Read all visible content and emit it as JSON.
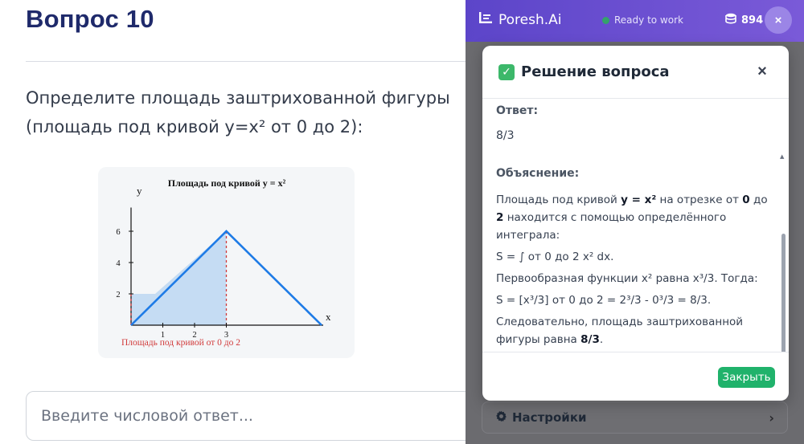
{
  "question": {
    "title": "Вопрос 10",
    "text": "Определите площадь заштрихованной фигуры (площадь под кривой y=x² от 0 до 2):",
    "input_placeholder": "Введите числовой ответ..."
  },
  "figure": {
    "title": "Площадь под кривой y = x²",
    "x_axis_label": "x",
    "y_axis_label": "y",
    "x_ticks": [
      "1",
      "2",
      "3"
    ],
    "y_ticks": [
      "2",
      "4",
      "6"
    ],
    "caption": "Площадь под кривой от 0 до 2",
    "colors": {
      "line": "#1e7be6",
      "fill": "#c5dcf3",
      "dashed": "#d13a3a",
      "caption": "#d13a3a"
    }
  },
  "chart_data": {
    "type": "line",
    "title": "Площадь под кривой y = x²",
    "xlabel": "x",
    "ylabel": "y",
    "series": [
      {
        "x": [
          0,
          3,
          6
        ],
        "y": [
          0,
          6,
          0
        ]
      }
    ],
    "shaded_region": {
      "x": [
        0,
        3
      ],
      "y_upper": [
        2,
        6
      ]
    },
    "xlim": [
      0,
      6
    ],
    "ylim": [
      0,
      7
    ],
    "grid": false
  },
  "panel": {
    "brand": "Poresh.Ai",
    "status": "Ready to work",
    "coins": "894",
    "close_label": "×",
    "settings_label": "Настройки",
    "header_color": "#6650d0"
  },
  "modal": {
    "title": "Решение вопроса",
    "close_label": "×",
    "answer_label": "Ответ:",
    "answer_value": "8/3",
    "explanation_label": "Объяснение:",
    "explanation": {
      "p1_a": "Площадь под кривой",
      "p1_b": "y = x²",
      "p1_c": "на отрезке от",
      "p1_d": "0",
      "p1_e": "до",
      "p1_f": "2",
      "p1_g": "находится с помощью определённого интеграла:",
      "p2": "S = ∫ от 0 до 2 x² dx.",
      "p3": "Первообразная функции x² равна x³/3. Тогда:",
      "p4": "S = [x³/3] от 0 до 2 = 2³/3 - 0³/3 = 8/3.",
      "p5_a": "Следовательно, площадь заштрихованной фигуры равна",
      "p5_b": "8/3",
      "p5_c": "."
    },
    "footer_button": "Закрыть"
  }
}
